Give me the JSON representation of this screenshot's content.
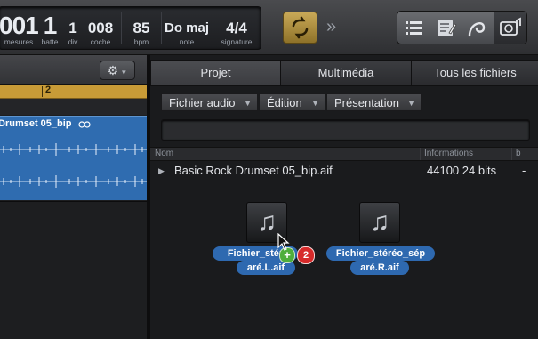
{
  "lcd": {
    "mesures_value": "001",
    "mesures_label": "mesures",
    "batte_value": "1",
    "batte_label": "batte",
    "div_value": "1",
    "div_label": "div",
    "coche_value": "008",
    "coche_label": "coche",
    "bpm_value": "85",
    "bpm_label": "bpm",
    "note_value": "Do maj",
    "note_label": "note",
    "signature_value": "4/4",
    "signature_label": "signature"
  },
  "tracks": {
    "ruler_bar": "2",
    "region_name": "Drumset 05_bip"
  },
  "browser": {
    "tabs": [
      "Projet",
      "Multimédia",
      "Tous les fichiers"
    ],
    "menus": [
      "Fichier audio",
      "Édition",
      "Présentation"
    ],
    "columns": {
      "name": "Nom",
      "info": "Informations",
      "extra": "b"
    },
    "row": {
      "name": "Basic Rock Drumset 05_bip.aif",
      "info": "44100 24 bits",
      "extra": "-"
    },
    "files": [
      {
        "line1": "Fichier_stéréo_sép",
        "line2": "aré.L.aif",
        "shown1": "Fichier_stér"
      },
      {
        "line1": "Fichier_stéréo_sép",
        "line2": "aré.R.aif"
      }
    ],
    "drag_count": "2",
    "drag_plus": "+"
  },
  "colors": {
    "accent_gold": "#c89b37",
    "region_blue": "#2f6cb0",
    "badge_red": "#d72a2a",
    "badge_green": "#4fae3c"
  },
  "icons": [
    "cycle-icon",
    "chevron-right-icon",
    "list-icon",
    "notepad-icon",
    "loop-icon",
    "media-browser-icon",
    "gear-icon",
    "music-note-icon",
    "disclosure-triangle-icon",
    "cursor-arrow-icon"
  ]
}
